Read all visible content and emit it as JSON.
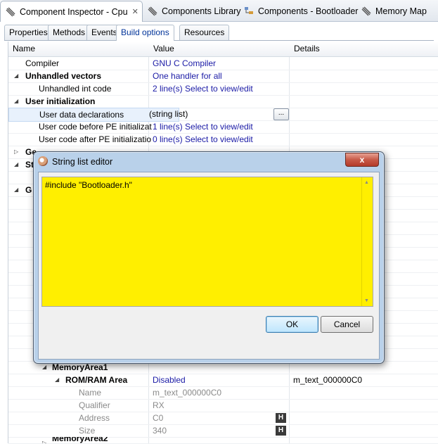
{
  "view_tabs": [
    {
      "label": "Component Inspector - Cpu",
      "icon": "component-inspector-icon",
      "active": true
    },
    {
      "label": "Components Library",
      "icon": "components-library-icon"
    },
    {
      "label": "Components - Bootloader",
      "icon": "components-tree-icon"
    },
    {
      "label": "Memory Map",
      "icon": "memory-map-icon"
    }
  ],
  "prop_tabs": [
    "Properties",
    "Methods",
    "Events",
    "Build options",
    "Resources"
  ],
  "active_prop_tab": "Build options",
  "columns": {
    "name": "Name",
    "value": "Value",
    "details": "Details"
  },
  "rows": [
    {
      "name": "Compiler",
      "value": "GNU C Compiler",
      "details": ""
    },
    {
      "name": "Unhandled vectors",
      "value": "One handler for all",
      "details": ""
    },
    {
      "name": "Unhandled int code",
      "value": "2 line(s)   Select to view/edit",
      "details": ""
    },
    {
      "name": "User initialization",
      "value": "",
      "details": ""
    },
    {
      "name": "User data declarations",
      "value": "(string list)",
      "details": ""
    },
    {
      "name": "User code before PE initializat",
      "value": "1 line(s)   Select to view/edit",
      "details": ""
    },
    {
      "name": "User code after PE initializatio",
      "value": "0 line(s)   Select to view/edit",
      "details": ""
    },
    {
      "name": "Ge",
      "value": "",
      "details": ""
    },
    {
      "name": "St",
      "value": "",
      "details": ""
    },
    {
      "name": "G",
      "value": "",
      "details": ""
    },
    {
      "name": "MemoryArea1",
      "value": "",
      "details": ""
    },
    {
      "name": "ROM/RAM Area",
      "value": "Disabled",
      "details": "m_text_000000C0"
    },
    {
      "name": "Name",
      "value": "m_text_000000C0",
      "details": ""
    },
    {
      "name": "Qualifier",
      "value": "RX",
      "details": ""
    },
    {
      "name": "Address",
      "value": "C0",
      "details": ""
    },
    {
      "name": "Size",
      "value": "340",
      "details": ""
    },
    {
      "name": "MemoryArea2",
      "value": "",
      "details": ""
    }
  ],
  "hex_button_label": "H",
  "ellipsis_label": "...",
  "dialog": {
    "title": "String list editor",
    "content": "#include \"Bootloader.h\"",
    "ok_label": "OK",
    "cancel_label": "Cancel",
    "close_label": "x",
    "editor_background": "#ffef00"
  }
}
